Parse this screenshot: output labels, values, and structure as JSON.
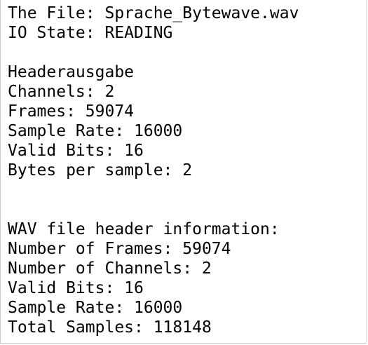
{
  "console": {
    "file_line": "The File: Sprache_Bytewave.wav",
    "io_state_line": "IO State: READING",
    "header_output": {
      "title": "Headerausgabe",
      "channels": "Channels: 2",
      "frames": "Frames: 59074",
      "sample_rate": "Sample Rate: 16000",
      "valid_bits": "Valid Bits: 16",
      "bytes_per_sample": "Bytes per sample: 2"
    },
    "wav_header_info": {
      "title": "WAV file header information:",
      "number_of_frames": "Number of Frames: 59074",
      "number_of_channels": "Number of Channels: 2",
      "valid_bits": "Valid Bits: 16",
      "sample_rate": "Sample Rate: 16000",
      "total_samples": "Total Samples: 118148"
    }
  }
}
